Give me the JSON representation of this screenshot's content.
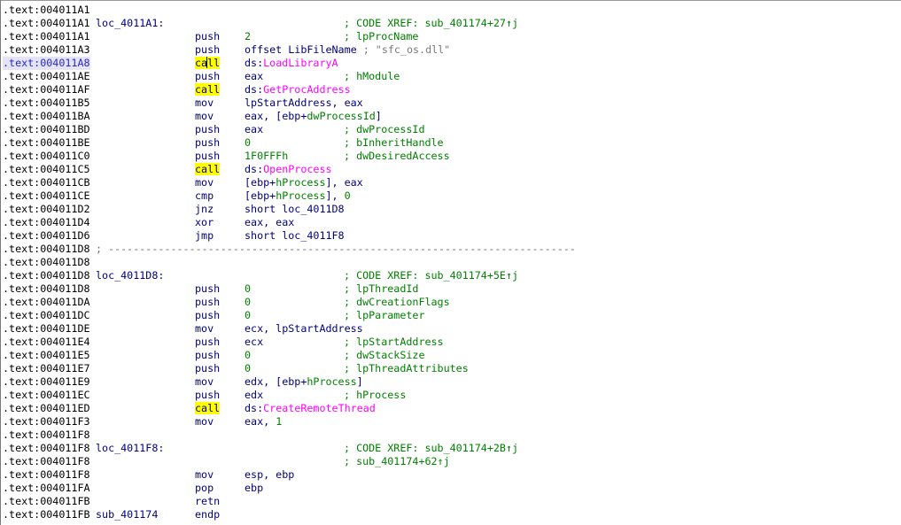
{
  "listing": {
    "lines": [
      {
        "addr": ".text:004011A1",
        "label": "",
        "mnem": "",
        "ops": [],
        "comment": "",
        "separator": ""
      },
      {
        "addr": ".text:004011A1",
        "label": "loc_4011A1:",
        "mnem": "",
        "ops": [],
        "comment": "; CODE XREF: sub_401174+27↑j",
        "separator": ""
      },
      {
        "addr": ".text:004011A1",
        "label": "",
        "mnem": "push",
        "ops": [
          {
            "t": "2",
            "c": "num"
          }
        ],
        "comment": "; lpProcName",
        "separator": ""
      },
      {
        "addr": ".text:004011A3",
        "label": "",
        "mnem": "push",
        "ops": [
          {
            "t": "offset LibFileName",
            "c": "name"
          },
          {
            "t": " ; \"sfc_os.dll\"",
            "c": "str"
          }
        ],
        "comment": "",
        "separator": ""
      },
      {
        "addr": ".text:004011A8",
        "label": "",
        "mnem": "call",
        "mnem_hl": true,
        "caret": true,
        "selected": true,
        "ops": [
          {
            "t": "ds:",
            "c": "name"
          },
          {
            "t": "LoadLibraryA",
            "c": "import"
          }
        ],
        "comment": "",
        "separator": ""
      },
      {
        "addr": ".text:004011AE",
        "label": "",
        "mnem": "push",
        "ops": [
          {
            "t": "eax",
            "c": "name"
          }
        ],
        "comment": "; hModule",
        "separator": ""
      },
      {
        "addr": ".text:004011AF",
        "label": "",
        "mnem": "call",
        "mnem_hl": true,
        "ops": [
          {
            "t": "ds:",
            "c": "name"
          },
          {
            "t": "GetProcAddress",
            "c": "import"
          }
        ],
        "comment": "",
        "separator": ""
      },
      {
        "addr": ".text:004011B5",
        "label": "",
        "mnem": "mov",
        "ops": [
          {
            "t": "lpStartAddress, eax",
            "c": "name"
          }
        ],
        "comment": "",
        "separator": ""
      },
      {
        "addr": ".text:004011BA",
        "label": "",
        "mnem": "mov",
        "ops": [
          {
            "t": "eax, [ebp+",
            "c": "name"
          },
          {
            "t": "dwProcessId",
            "c": "var"
          },
          {
            "t": "]",
            "c": "name"
          }
        ],
        "comment": "",
        "separator": ""
      },
      {
        "addr": ".text:004011BD",
        "label": "",
        "mnem": "push",
        "ops": [
          {
            "t": "eax",
            "c": "name"
          }
        ],
        "comment": "; dwProcessId",
        "separator": ""
      },
      {
        "addr": ".text:004011BE",
        "label": "",
        "mnem": "push",
        "ops": [
          {
            "t": "0",
            "c": "num"
          }
        ],
        "comment": "; bInheritHandle",
        "separator": ""
      },
      {
        "addr": ".text:004011C0",
        "label": "",
        "mnem": "push",
        "ops": [
          {
            "t": "1F0FFFh",
            "c": "num"
          }
        ],
        "comment": "; dwDesiredAccess",
        "separator": ""
      },
      {
        "addr": ".text:004011C5",
        "label": "",
        "mnem": "call",
        "mnem_hl": true,
        "ops": [
          {
            "t": "ds:",
            "c": "name"
          },
          {
            "t": "OpenProcess",
            "c": "import"
          }
        ],
        "comment": "",
        "separator": ""
      },
      {
        "addr": ".text:004011CB",
        "label": "",
        "mnem": "mov",
        "ops": [
          {
            "t": "[ebp+",
            "c": "name"
          },
          {
            "t": "hProcess",
            "c": "var"
          },
          {
            "t": "], eax",
            "c": "name"
          }
        ],
        "comment": "",
        "separator": ""
      },
      {
        "addr": ".text:004011CE",
        "label": "",
        "mnem": "cmp",
        "ops": [
          {
            "t": "[ebp+",
            "c": "name"
          },
          {
            "t": "hProcess",
            "c": "var"
          },
          {
            "t": "], ",
            "c": "name"
          },
          {
            "t": "0",
            "c": "num"
          }
        ],
        "comment": "",
        "separator": ""
      },
      {
        "addr": ".text:004011D2",
        "label": "",
        "mnem": "jnz",
        "ops": [
          {
            "t": "short loc_4011D8",
            "c": "name"
          }
        ],
        "comment": "",
        "separator": ""
      },
      {
        "addr": ".text:004011D4",
        "label": "",
        "mnem": "xor",
        "ops": [
          {
            "t": "eax, eax",
            "c": "name"
          }
        ],
        "comment": "",
        "separator": ""
      },
      {
        "addr": ".text:004011D6",
        "label": "",
        "mnem": "jmp",
        "ops": [
          {
            "t": "short loc_4011F8",
            "c": "name"
          }
        ],
        "comment": "",
        "separator": ""
      },
      {
        "addr": ".text:004011D8",
        "label": "",
        "mnem": "",
        "ops": [],
        "comment": "",
        "separator": "; ---------------------------------------------------------------------------"
      },
      {
        "addr": ".text:004011D8",
        "label": "",
        "mnem": "",
        "ops": [],
        "comment": "",
        "separator": ""
      },
      {
        "addr": ".text:004011D8",
        "label": "loc_4011D8:",
        "mnem": "",
        "ops": [],
        "comment": "; CODE XREF: sub_401174+5E↑j",
        "separator": ""
      },
      {
        "addr": ".text:004011D8",
        "label": "",
        "mnem": "push",
        "ops": [
          {
            "t": "0",
            "c": "num"
          }
        ],
        "comment": "; lpThreadId",
        "separator": ""
      },
      {
        "addr": ".text:004011DA",
        "label": "",
        "mnem": "push",
        "ops": [
          {
            "t": "0",
            "c": "num"
          }
        ],
        "comment": "; dwCreationFlags",
        "separator": ""
      },
      {
        "addr": ".text:004011DC",
        "label": "",
        "mnem": "push",
        "ops": [
          {
            "t": "0",
            "c": "num"
          }
        ],
        "comment": "; lpParameter",
        "separator": ""
      },
      {
        "addr": ".text:004011DE",
        "label": "",
        "mnem": "mov",
        "ops": [
          {
            "t": "ecx, lpStartAddress",
            "c": "name"
          }
        ],
        "comment": "",
        "separator": ""
      },
      {
        "addr": ".text:004011E4",
        "label": "",
        "mnem": "push",
        "ops": [
          {
            "t": "ecx",
            "c": "name"
          }
        ],
        "comment": "; lpStartAddress",
        "separator": ""
      },
      {
        "addr": ".text:004011E5",
        "label": "",
        "mnem": "push",
        "ops": [
          {
            "t": "0",
            "c": "num"
          }
        ],
        "comment": "; dwStackSize",
        "separator": ""
      },
      {
        "addr": ".text:004011E7",
        "label": "",
        "mnem": "push",
        "ops": [
          {
            "t": "0",
            "c": "num"
          }
        ],
        "comment": "; lpThreadAttributes",
        "separator": ""
      },
      {
        "addr": ".text:004011E9",
        "label": "",
        "mnem": "mov",
        "ops": [
          {
            "t": "edx, [ebp+",
            "c": "name"
          },
          {
            "t": "hProcess",
            "c": "var"
          },
          {
            "t": "]",
            "c": "name"
          }
        ],
        "comment": "",
        "separator": ""
      },
      {
        "addr": ".text:004011EC",
        "label": "",
        "mnem": "push",
        "ops": [
          {
            "t": "edx",
            "c": "name"
          }
        ],
        "comment": "; hProcess",
        "separator": ""
      },
      {
        "addr": ".text:004011ED",
        "label": "",
        "mnem": "call",
        "mnem_hl": true,
        "ops": [
          {
            "t": "ds:",
            "c": "name"
          },
          {
            "t": "CreateRemoteThread",
            "c": "import"
          }
        ],
        "comment": "",
        "separator": ""
      },
      {
        "addr": ".text:004011F3",
        "label": "",
        "mnem": "mov",
        "ops": [
          {
            "t": "eax, ",
            "c": "name"
          },
          {
            "t": "1",
            "c": "num"
          }
        ],
        "comment": "",
        "separator": ""
      },
      {
        "addr": ".text:004011F8",
        "label": "",
        "mnem": "",
        "ops": [],
        "comment": "",
        "separator": ""
      },
      {
        "addr": ".text:004011F8",
        "label": "loc_4011F8:",
        "mnem": "",
        "ops": [],
        "comment": "; CODE XREF: sub_401174+2B↑j",
        "separator": ""
      },
      {
        "addr": ".text:004011F8",
        "label": "",
        "mnem": "",
        "ops": [],
        "comment": "; sub_401174+62↑j",
        "separator": ""
      },
      {
        "addr": ".text:004011F8",
        "label": "",
        "mnem": "mov",
        "ops": [
          {
            "t": "esp, ebp",
            "c": "name"
          }
        ],
        "comment": "",
        "separator": ""
      },
      {
        "addr": ".text:004011FA",
        "label": "",
        "mnem": "pop",
        "ops": [
          {
            "t": "ebp",
            "c": "name"
          }
        ],
        "comment": "",
        "separator": ""
      },
      {
        "addr": ".text:004011FB",
        "label": "",
        "mnem": "retn",
        "ops": [],
        "comment": "",
        "separator": ""
      },
      {
        "addr": ".text:004011FB",
        "label": "sub_401174",
        "mnem": "endp",
        "ops": [],
        "comment": "",
        "separator": ""
      }
    ]
  },
  "colors": {
    "background": "#ffffff",
    "address": "#000000",
    "instruction": "#000080",
    "comment": "#008000",
    "import": "#ff00ff",
    "highlight": "#ffff00",
    "string": "#7a7a7a"
  }
}
